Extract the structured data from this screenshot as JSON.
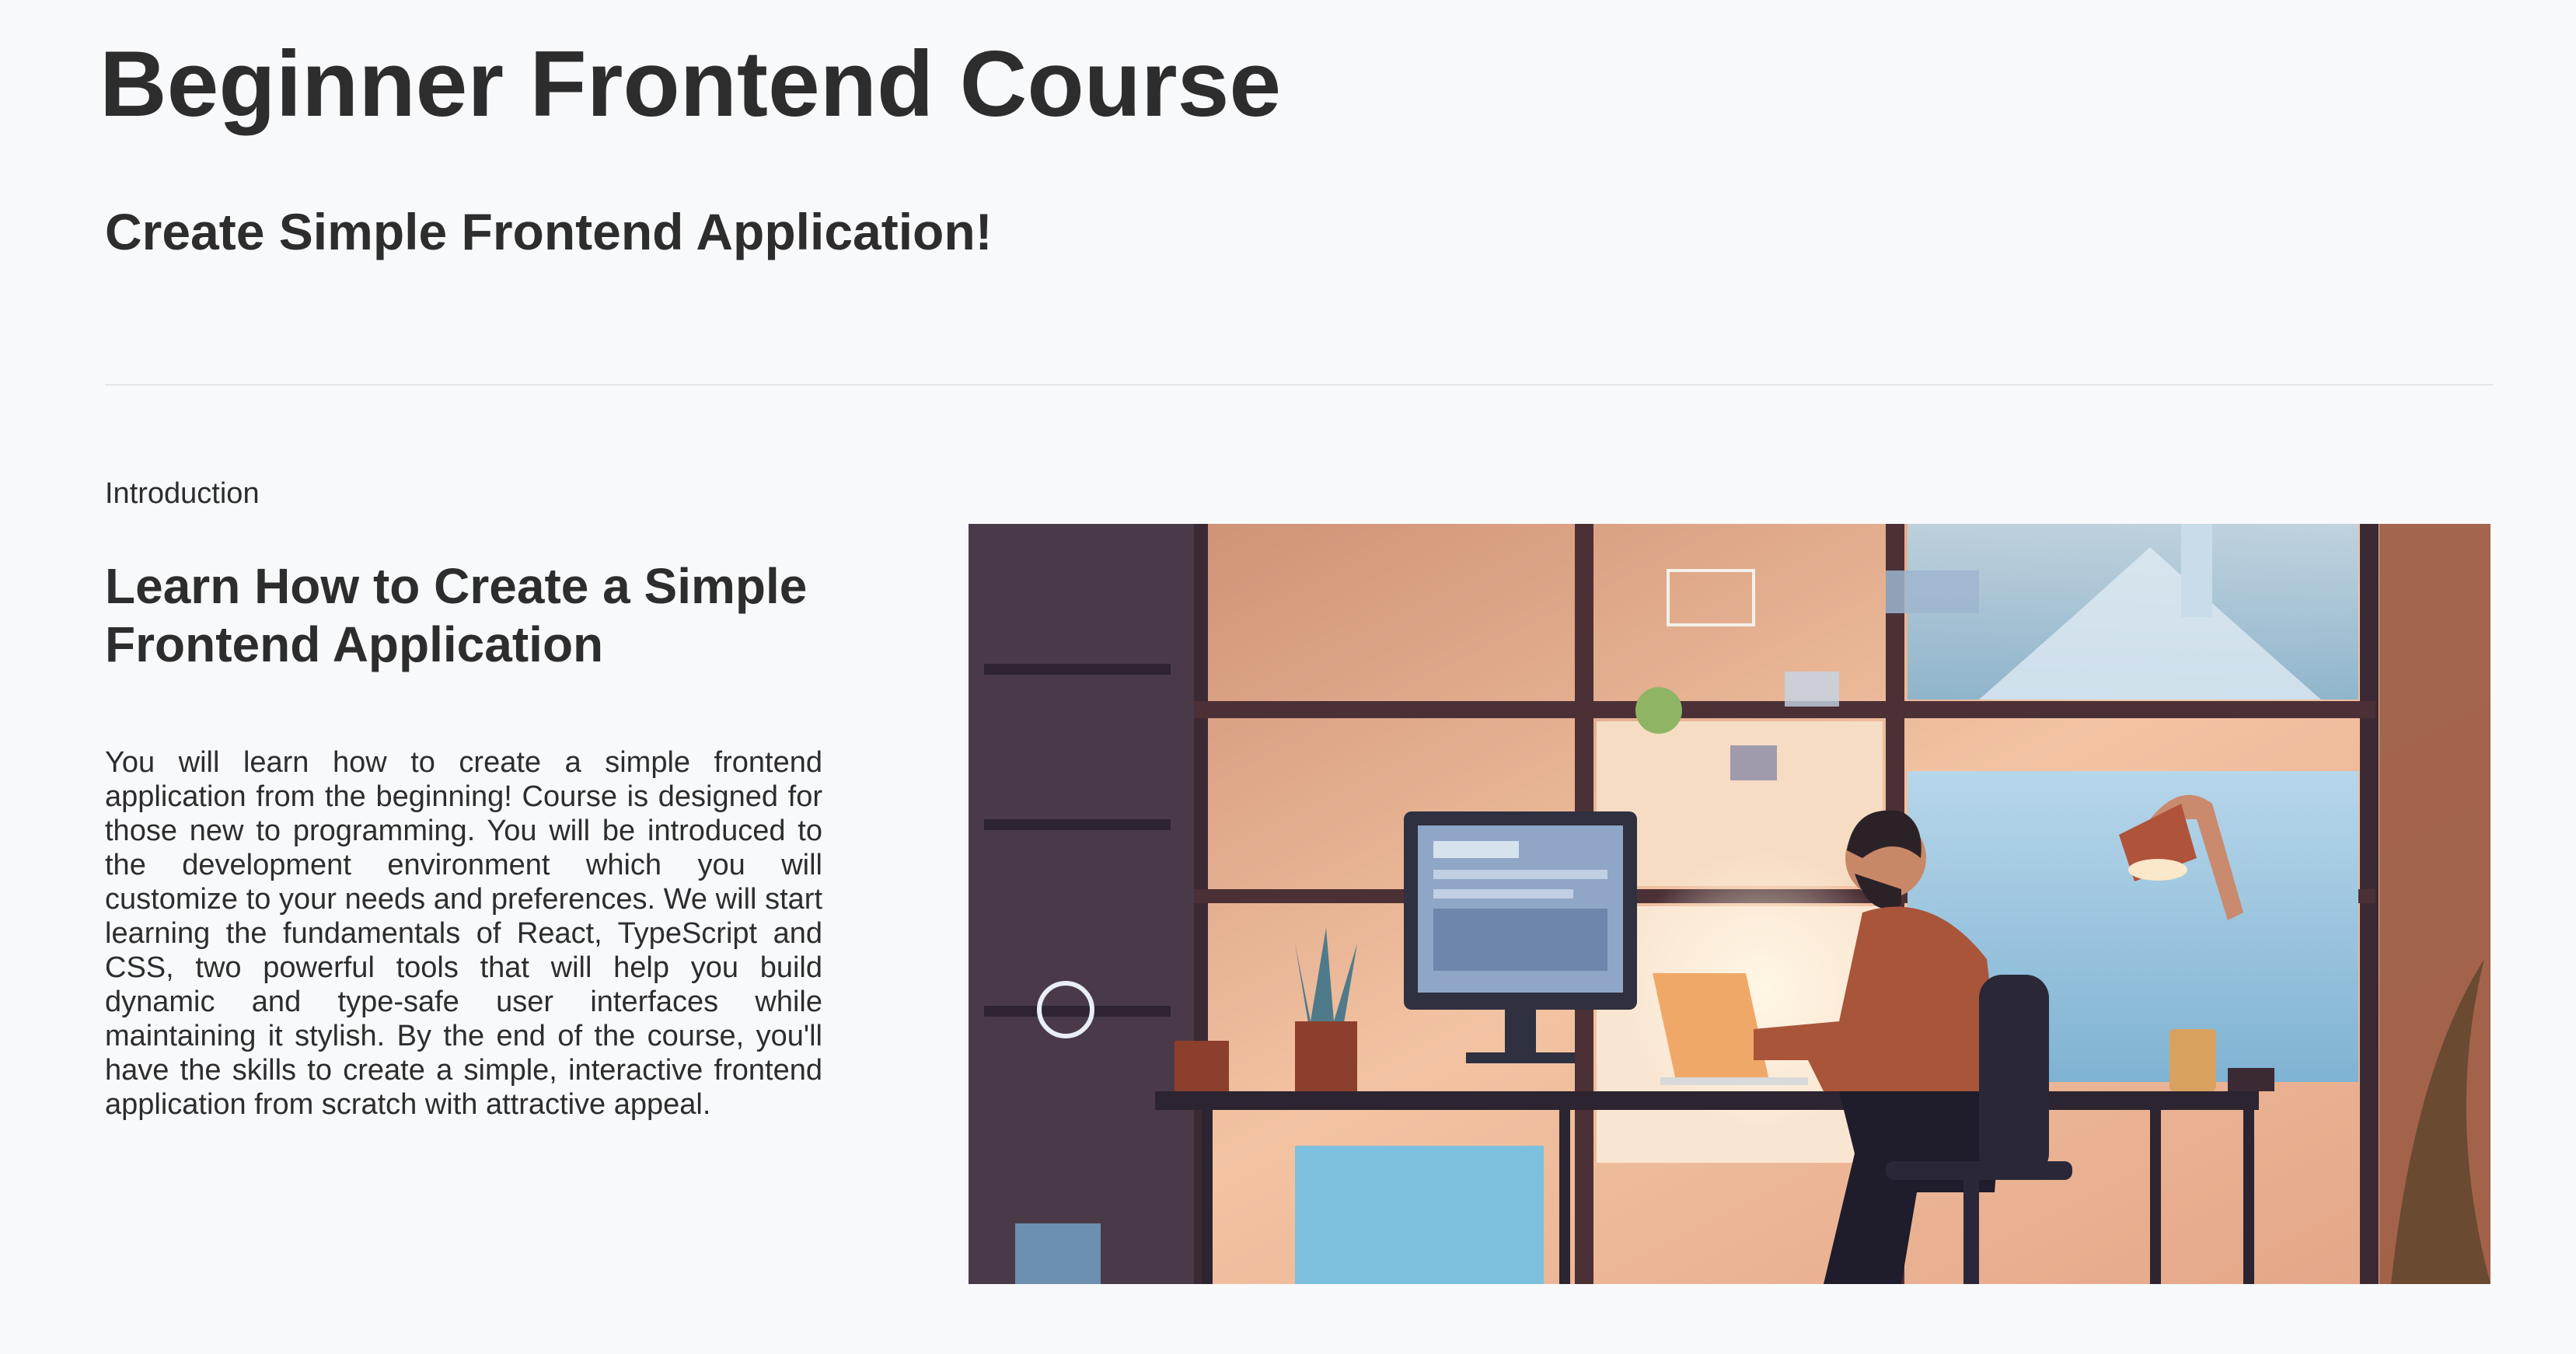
{
  "course": {
    "title": "Beginner Frontend Course",
    "subtitle": "Create Simple Frontend Application!"
  },
  "introduction": {
    "label": "Introduction",
    "heading": "Learn How to Create a Simple Frontend Application",
    "body": "You will learn how to create a simple frontend application from the beginning! Course is designed for those new to programming. You will be introduced to the development environment which you will customize to your needs and preferences. We will start learning the fundamentals of React, TypeScript and CSS, two powerful tools that will help you build dynamic and type-safe user interfaces while maintaining it stylish. By the end of the course, you'll have the skills to create a simple, interactive frontend application from scratch with attractive appeal."
  },
  "hero_image": {
    "subject": "illustration-developer-at-desk",
    "colors": {
      "warm": "#e8a57c",
      "light": "#fbe2cb",
      "dark": "#3a3140",
      "blue": "#9cc5de",
      "hoodie": "#a9553a"
    }
  }
}
